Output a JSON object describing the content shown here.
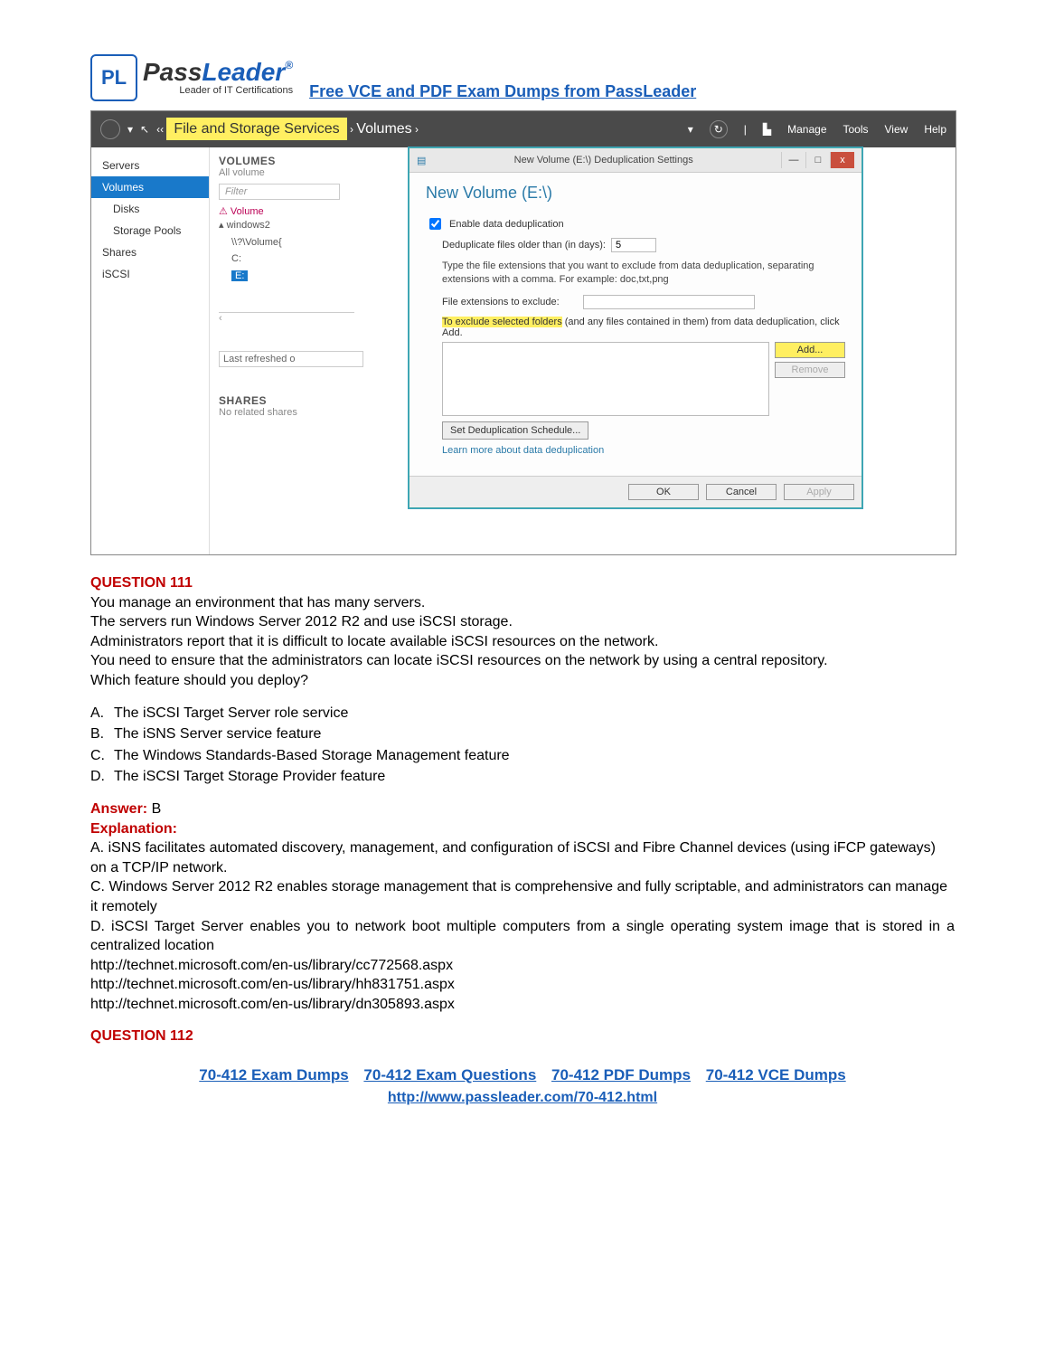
{
  "header": {
    "logo_badge": "PL",
    "logo_pass": "Pass",
    "logo_leader": "Leader",
    "logo_reg": "®",
    "logo_sub": "Leader of IT Certifications",
    "link": "Free VCE and PDF Exam Dumps from PassLeader"
  },
  "sm": {
    "breadcrumb_prefix": "‹‹ ",
    "breadcrumb_1": "File and Storage Services",
    "breadcrumb_sep": " › ",
    "breadcrumb_2": "Volumes",
    "breadcrumb_suffix": " ›",
    "menu": {
      "manage": "Manage",
      "tools": "Tools",
      "view": "View",
      "help": "Help"
    },
    "sidebar": {
      "servers": "Servers",
      "volumes": "Volumes",
      "disks": "Disks",
      "pools": "Storage Pools",
      "shares": "Shares",
      "iscsi": "iSCSI"
    },
    "main": {
      "volumes_title": "VOLUMES",
      "all_volumes": "All volume",
      "filter_placeholder": "Filter",
      "volume_col": "Volume",
      "node": "windows2",
      "row1": "\\\\?\\Volume{",
      "row2": "C:",
      "row3": "E:",
      "last_refreshed": "Last refreshed o",
      "shares_title": "SHARES",
      "no_shares": "No related shares"
    }
  },
  "dialog": {
    "title": "New Volume (E:\\) Deduplication Settings",
    "heading": "New Volume (E:\\)",
    "enable_label": "Enable data deduplication",
    "older_label": "Deduplicate files older than (in days):",
    "older_value": "5",
    "type_note": "Type the file extensions that you want to exclude from data deduplication, separating extensions with a comma. For example: doc,txt,png",
    "ext_label": "File extensions to exclude:",
    "exclude_note_prefix": "To exclude selected folders",
    "exclude_note_suffix": " (and any files contained in them) from data deduplication, click Add.",
    "add_btn": "Add...",
    "remove_btn": "Remove",
    "sched_btn": "Set Deduplication Schedule...",
    "learn_link": "Learn more about data deduplication",
    "ok": "OK",
    "cancel": "Cancel",
    "apply": "Apply",
    "min": "—",
    "max": "□",
    "close": "x"
  },
  "q111": {
    "num": "QUESTION 111",
    "p1": "You manage an environment that has many servers.",
    "p2": "The servers run Windows Server 2012 R2 and use iSCSI storage.",
    "p3": "Administrators report that it is difficult to locate available iSCSI resources on the network.",
    "p4": "You need to ensure that the administrators can locate iSCSI resources on the network by using a central repository.",
    "p5": "Which feature should you deploy?",
    "opts": {
      "a": "The iSCSI Target Server role service",
      "b": "The iSNS Server service feature",
      "c": "The Windows Standards-Based Storage Management feature",
      "d": "The iSCSI Target Storage Provider feature"
    },
    "answer_label": "Answer: ",
    "answer_val": "B",
    "expl_label": "Explanation:",
    "ea": "A. iSNS facilitates automated discovery, management, and configuration of iSCSI and Fibre Channel devices (using iFCP gateways) on a TCP/IP network.",
    "ec": "C. Windows Server 2012 R2 enables storage management that is comprehensive and fully scriptable, and administrators can manage it remotely",
    "ed": "D. iSCSI Target Server enables you to network boot multiple computers from a single operating system image that is stored in a centralized location",
    "r1": "http://technet.microsoft.com/en-us/library/cc772568.aspx",
    "r2": "http://technet.microsoft.com/en-us/library/hh831751.aspx",
    "r3": "http://technet.microsoft.com/en-us/library/dn305893.aspx"
  },
  "q112": {
    "num": "QUESTION 112"
  },
  "footer": {
    "l1": "70-412 Exam Dumps",
    "l2": "70-412 Exam Questions",
    "l3": "70-412 PDF Dumps",
    "l4": "70-412 VCE Dumps",
    "url": "http://www.passleader.com/70-412.html"
  }
}
